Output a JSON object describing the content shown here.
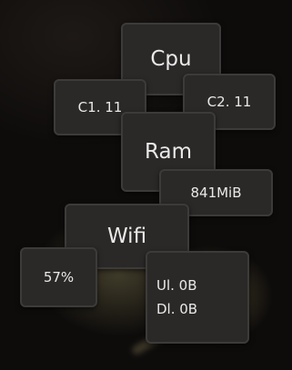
{
  "cpu": {
    "title": "Cpu",
    "core1": "C1. 11",
    "core2": "C2. 11"
  },
  "ram": {
    "title": "Ram",
    "used": "841MiB"
  },
  "wifi": {
    "title": "Wifi",
    "signal": "57%",
    "upload": "Ul. 0B",
    "download": "Dl. 0B"
  }
}
